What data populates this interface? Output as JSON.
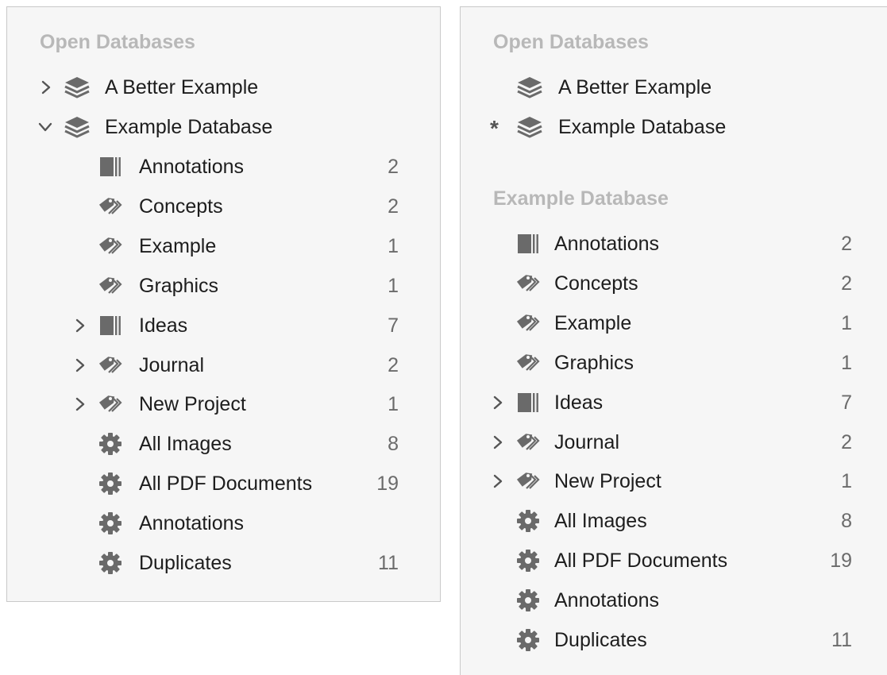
{
  "left_panel": {
    "section_title": "Open Databases",
    "databases": [
      {
        "label": "A Better Example",
        "icon": "database-stack-icon",
        "expanded": false
      },
      {
        "label": "Example Database",
        "icon": "database-stack-icon",
        "expanded": true
      }
    ],
    "items": [
      {
        "label": "Annotations",
        "icon": "group-icon",
        "count": "2",
        "has_children": false
      },
      {
        "label": "Concepts",
        "icon": "tags-icon",
        "count": "2",
        "has_children": false
      },
      {
        "label": "Example",
        "icon": "tags-icon",
        "count": "1",
        "has_children": false
      },
      {
        "label": "Graphics",
        "icon": "tags-icon",
        "count": "1",
        "has_children": false
      },
      {
        "label": "Ideas",
        "icon": "group-icon",
        "count": "7",
        "has_children": true
      },
      {
        "label": "Journal",
        "icon": "tags-icon",
        "count": "2",
        "has_children": true
      },
      {
        "label": "New Project",
        "icon": "tags-icon",
        "count": "1",
        "has_children": true
      },
      {
        "label": "All Images",
        "icon": "smart-group-gear-icon",
        "count": "8",
        "has_children": false
      },
      {
        "label": "All PDF Documents",
        "icon": "smart-group-gear-icon",
        "count": "19",
        "has_children": false
      },
      {
        "label": "Annotations",
        "icon": "smart-group-gear-icon",
        "count": "",
        "has_children": false
      },
      {
        "label": "Duplicates",
        "icon": "smart-group-gear-icon",
        "count": "11",
        "has_children": false
      }
    ]
  },
  "right_panel": {
    "section_title": "Open Databases",
    "databases": [
      {
        "label": "A Better Example",
        "icon": "database-stack-icon",
        "marker": ""
      },
      {
        "label": "Example Database",
        "icon": "database-stack-icon",
        "marker": "*"
      }
    ],
    "database_section_title": "Example Database",
    "items": [
      {
        "label": "Annotations",
        "icon": "group-icon",
        "count": "2",
        "has_children": false
      },
      {
        "label": "Concepts",
        "icon": "tags-icon",
        "count": "2",
        "has_children": false
      },
      {
        "label": "Example",
        "icon": "tags-icon",
        "count": "1",
        "has_children": false
      },
      {
        "label": "Graphics",
        "icon": "tags-icon",
        "count": "1",
        "has_children": false
      },
      {
        "label": "Ideas",
        "icon": "group-icon",
        "count": "7",
        "has_children": true
      },
      {
        "label": "Journal",
        "icon": "tags-icon",
        "count": "2",
        "has_children": true
      },
      {
        "label": "New Project",
        "icon": "tags-icon",
        "count": "1",
        "has_children": true
      },
      {
        "label": "All Images",
        "icon": "smart-group-gear-icon",
        "count": "8",
        "has_children": false
      },
      {
        "label": "All PDF Documents",
        "icon": "smart-group-gear-icon",
        "count": "19",
        "has_children": false
      },
      {
        "label": "Annotations",
        "icon": "smart-group-gear-icon",
        "count": "",
        "has_children": false
      },
      {
        "label": "Duplicates",
        "icon": "smart-group-gear-icon",
        "count": "11",
        "has_children": false
      }
    ]
  },
  "colors": {
    "panel_bg": "#f6f6f6",
    "section_title": "#b8b8b8",
    "icon": "#6a6a6a",
    "text": "#1d1d1d",
    "count": "#6b6b6b"
  }
}
